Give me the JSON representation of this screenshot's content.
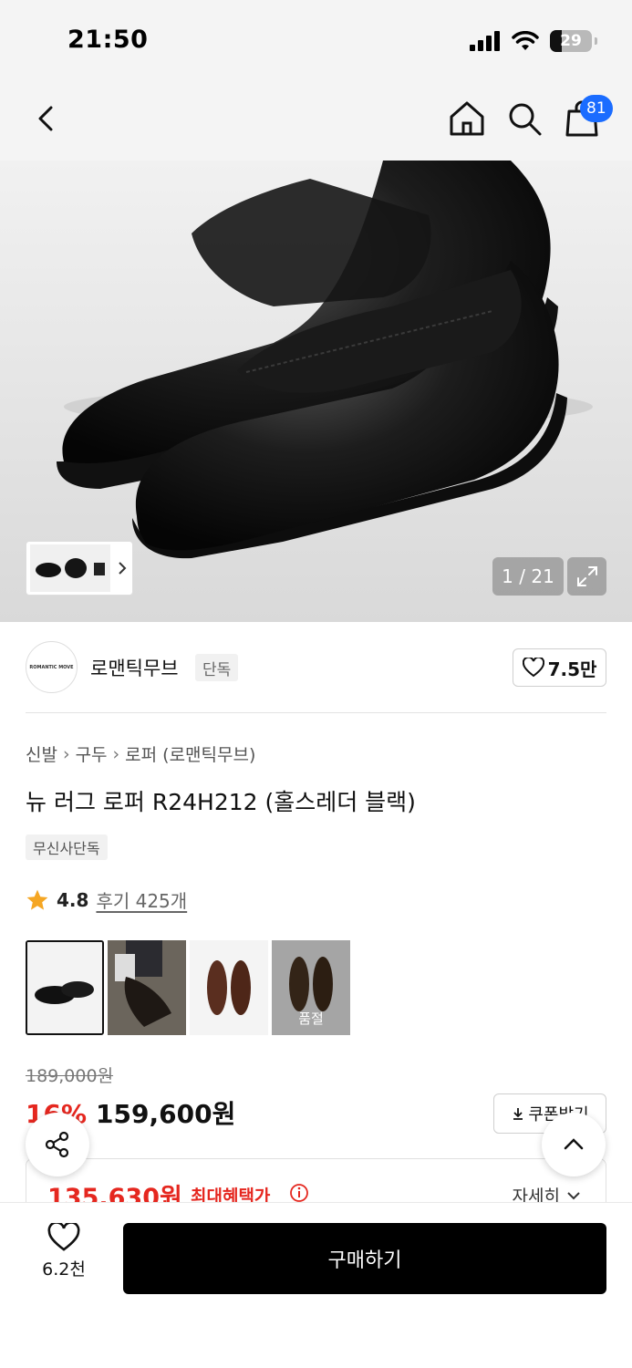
{
  "status_bar": {
    "time": "21:50",
    "battery": "29"
  },
  "nav": {
    "cart_count": "81"
  },
  "hero": {
    "counter": "1 / 21"
  },
  "brand": {
    "logo_text": "ROMANTIC MOVE",
    "name": "로맨틱무브",
    "tag": "단독",
    "likes": "7.5만"
  },
  "product": {
    "breadcrumb": [
      "신발",
      "구두",
      "로퍼 (로맨틱무브)"
    ],
    "title": "뉴 러그 로퍼 R24H212 (홀스레더 블랙)",
    "exclusive_tag": "무신사단독",
    "rating": "4.8",
    "review_text": "후기 425개",
    "options": [
      {
        "label": "black",
        "color": "#1c1c1c",
        "selected": true
      },
      {
        "label": "black-worn",
        "color": "#2a2420",
        "selected": false
      },
      {
        "label": "brown",
        "color": "#5a2e1f",
        "selected": false
      },
      {
        "label": "suede-brown",
        "color": "#4a3421",
        "selected": false,
        "soldout_label": "품절"
      }
    ]
  },
  "price": {
    "original": "189,000원",
    "discount": "16%",
    "sale": "159,600원",
    "coupon_label": "쿠폰받기",
    "benefit_price": "135,630원",
    "benefit_label": "최대혜택가",
    "detail_label": "자세히"
  },
  "bottom": {
    "like_count": "6.2천",
    "buy_label": "구매하기"
  },
  "colors": {
    "accent_red": "#e5271f",
    "badge_blue": "#1a6cff"
  }
}
